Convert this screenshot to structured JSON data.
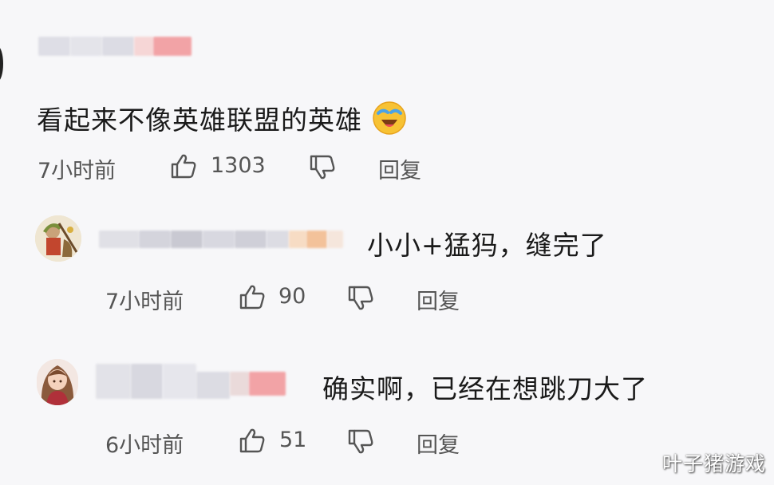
{
  "comments": [
    {
      "text": "看起来不像英雄联盟的英雄",
      "emoji_icon": "crying-laughing-emoji-icon",
      "time": "7小时前",
      "likes": "1303",
      "reply_label": "回复"
    },
    {
      "text": "小小+猛犸，缝完了",
      "time": "7小时前",
      "likes": "90",
      "reply_label": "回复"
    },
    {
      "text": "确实啊，已经在想跳刀大了",
      "time": "6小时前",
      "likes": "51",
      "reply_label": "回复"
    }
  ],
  "watermark": "叶子猪游戏",
  "colors": {
    "background": "#f7f7f9",
    "text": "#1a1a1a",
    "meta": "#555555",
    "blur_gray": "#d9d9e0",
    "blur_pink": "#f3a6a8"
  }
}
